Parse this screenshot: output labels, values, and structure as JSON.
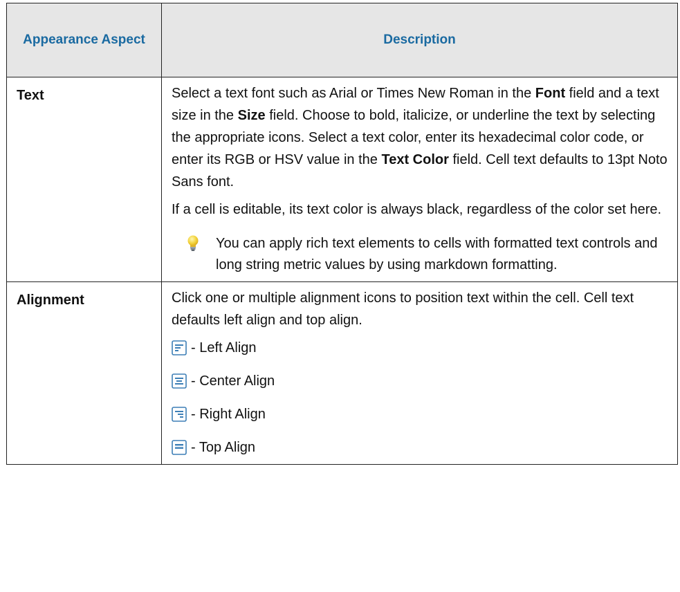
{
  "header": {
    "aspect": "Appearance Aspect",
    "description": "Description"
  },
  "rows": [
    {
      "aspect": "Text",
      "paragraph1": {
        "s1": "Select a text font such as Arial or Times New Roman in the ",
        "b1": "Font",
        "s2": " field and a text size in the ",
        "b2": "Size",
        "s3": " field. Choose to bold, italicize, or underline the text by selecting the appropriate icons. Select a text color, enter its hexadecimal color code, or enter its RGB or HSV value in the ",
        "b3": "Text Color",
        "s4": " field. Cell text defaults to 13pt Noto Sans font."
      },
      "paragraph2": "If a cell is editable, its text color is always black, regardless of the color set here.",
      "tip": {
        "icon": "lightbulb-icon",
        "text": "You can apply rich text elements to cells with formatted text controls and long string metric values by using markdown formatting."
      }
    },
    {
      "aspect": "Alignment",
      "intro": "Click one or multiple alignment icons to position text within the cell. Cell text defaults left align and top align.",
      "options": [
        {
          "icon": "align-left-icon",
          "label": "- Left Align"
        },
        {
          "icon": "align-center-icon",
          "label": "- Center Align"
        },
        {
          "icon": "align-right-icon",
          "label": "- Right Align"
        },
        {
          "icon": "align-top-icon",
          "label": "- Top Align"
        }
      ]
    }
  ],
  "colors": {
    "header_bg": "#e6e6e6",
    "header_text": "#1a6aa1",
    "border": "#222222",
    "icon_blue": "#3d7fb6"
  }
}
